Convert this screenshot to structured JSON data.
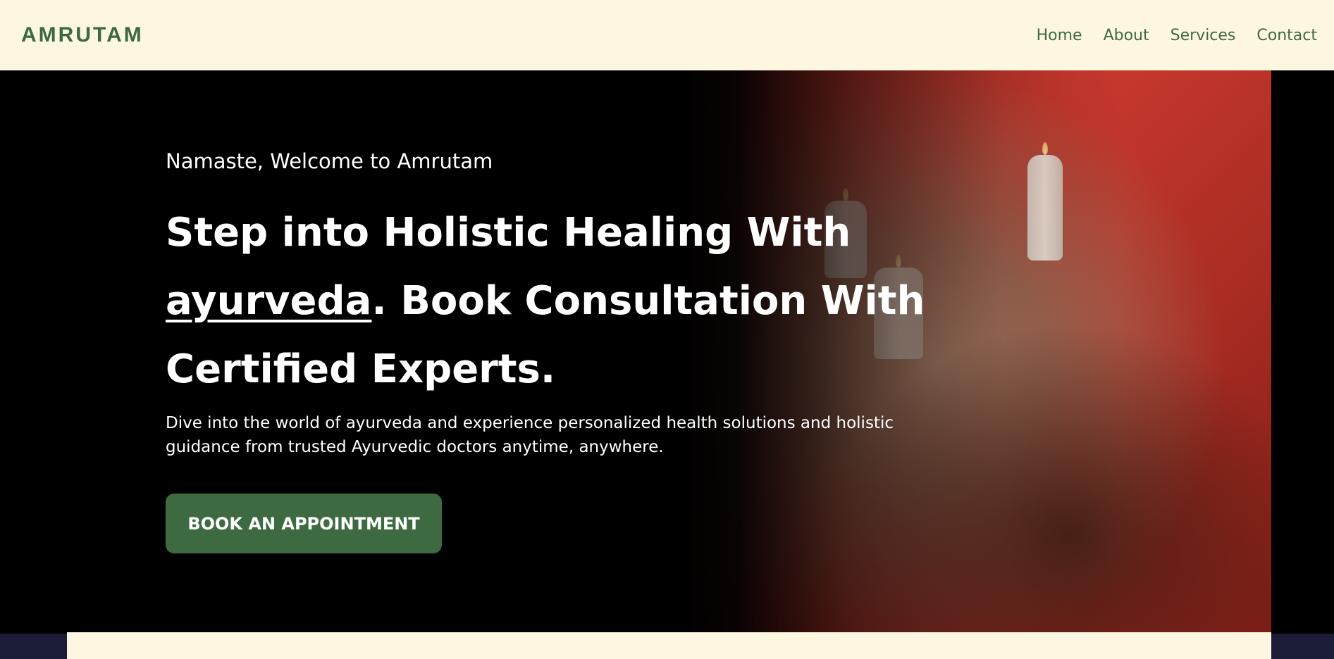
{
  "header": {
    "logo": "AMRUTAM",
    "nav": [
      {
        "label": "Home"
      },
      {
        "label": "About"
      },
      {
        "label": "Services"
      },
      {
        "label": "Contact"
      }
    ]
  },
  "hero": {
    "greeting": "Namaste, Welcome to Amrutam",
    "headline_part1": "Step into Holistic Healing With ",
    "headline_highlight": "ayurveda",
    "headline_part2": ". Book Consultation With Certified Experts.",
    "description": "Dive into the world of ayurveda and experience personalized health solutions and holistic guidance from trusted Ayurvedic doctors anytime, anywhere.",
    "cta_label": "BOOK AN APPOINTMENT"
  },
  "colors": {
    "brand_green": "#3d6a41",
    "header_bg": "#fdf6e1",
    "hero_bg": "#000000"
  }
}
